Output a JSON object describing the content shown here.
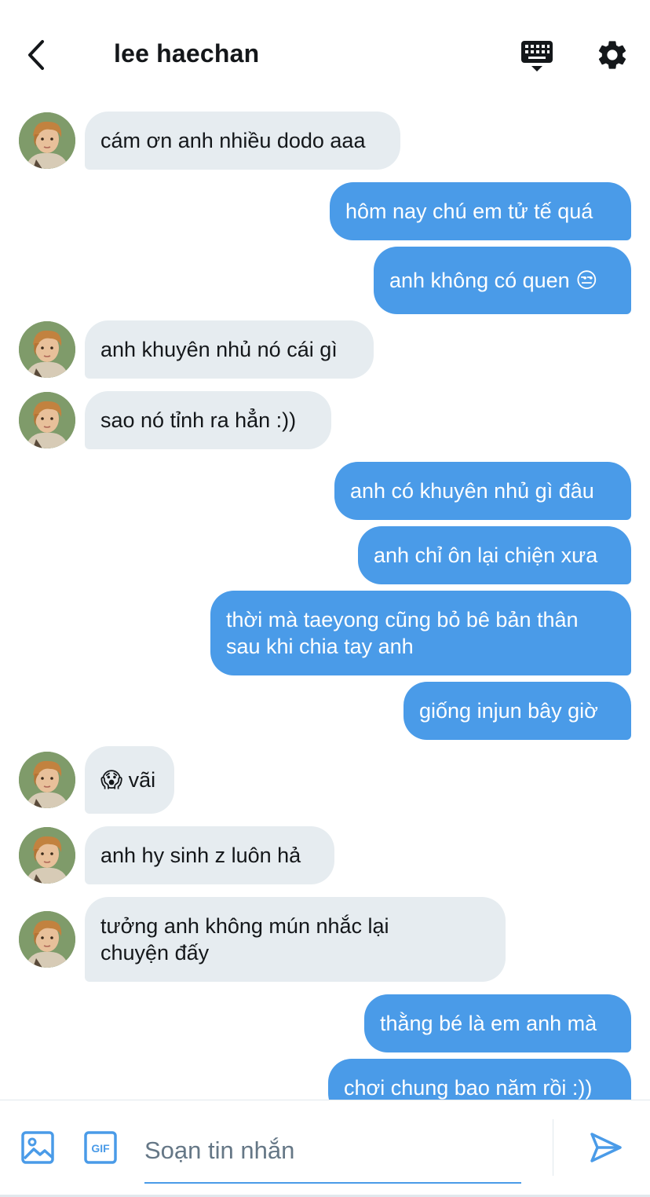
{
  "header": {
    "title": "lee haechan",
    "back_icon": "chevron-left-icon",
    "keyboard_icon": "keyboard-icon",
    "settings_icon": "gear-icon"
  },
  "messages": [
    {
      "side": "in",
      "text": "cám ơn anh nhiều dodo aaa"
    },
    {
      "side": "out",
      "text": "hôm nay chú em tử tế quá"
    },
    {
      "side": "out",
      "text": "anh không có quen 😒"
    },
    {
      "side": "in",
      "text": "anh khuyên nhủ nó cái gì"
    },
    {
      "side": "in",
      "text": "sao nó tỉnh ra hẳn :))"
    },
    {
      "side": "out",
      "text": "anh có khuyên nhủ gì đâu"
    },
    {
      "side": "out",
      "text": "anh chỉ ôn lại chiện xưa"
    },
    {
      "side": "out",
      "text": "thời mà taeyong cũng bỏ bê bản thân\nsau khi chia tay anh"
    },
    {
      "side": "out",
      "text": "giống injun bây giờ"
    },
    {
      "side": "in",
      "text": "😱 vãi"
    },
    {
      "side": "in",
      "text": "anh hy sinh z luôn hả"
    },
    {
      "side": "in",
      "text": "tưởng anh không mún nhắc lại\nchuyện đấy"
    },
    {
      "side": "out",
      "text": "thằng bé là em anh mà"
    },
    {
      "side": "out",
      "text": "chơi chung bao năm rồi :))"
    }
  ],
  "composer": {
    "placeholder": "Soạn tin nhắn",
    "value": "",
    "image_icon": "image-icon",
    "gif_icon": "gif-icon",
    "gif_label": "GIF",
    "send_icon": "send-icon"
  },
  "colors": {
    "accent": "#4a9be8",
    "incoming_bubble": "#e6ecf0",
    "text": "#14171a",
    "muted": "#657786"
  }
}
